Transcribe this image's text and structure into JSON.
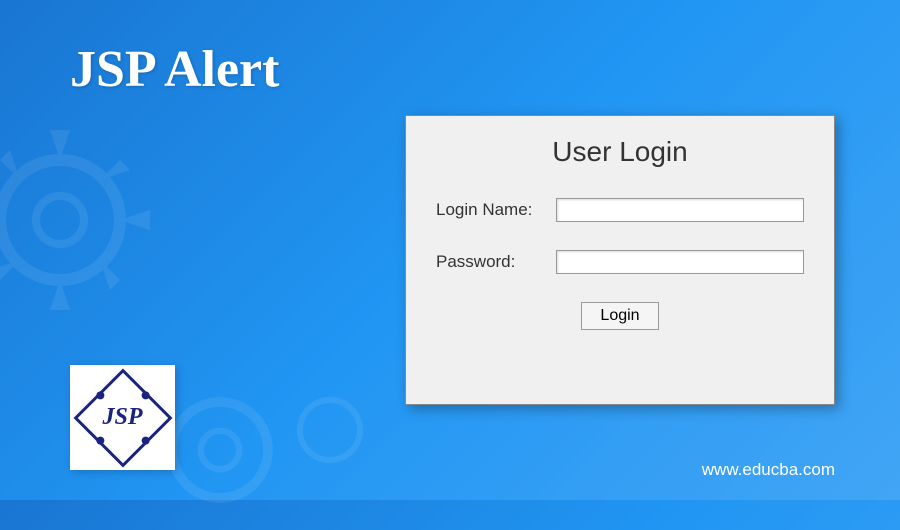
{
  "page": {
    "title": "JSP Alert",
    "site_url": "www.educba.com"
  },
  "logo": {
    "text": "JSP"
  },
  "login_panel": {
    "heading": "User Login",
    "username_label": "Login Name:",
    "password_label": "Password:",
    "username_value": "",
    "password_value": "",
    "submit_label": "Login"
  },
  "colors": {
    "background_start": "#1976d2",
    "background_end": "#42a5f5",
    "panel_bg": "#f0f0f0",
    "logo_accent": "#1a237e"
  }
}
